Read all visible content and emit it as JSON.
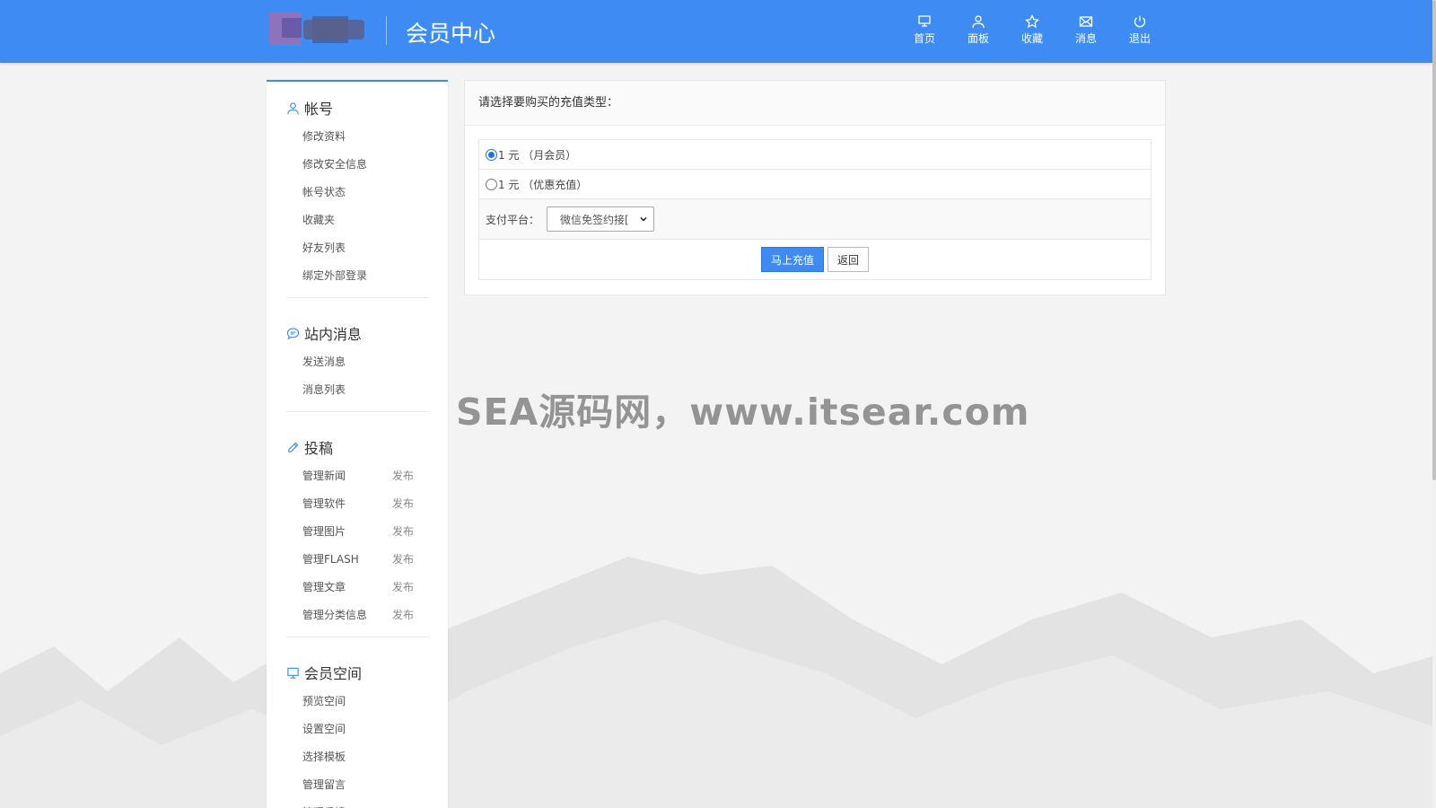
{
  "header": {
    "title": "会员中心",
    "nav": [
      {
        "label": "首页",
        "icon": "monitor-icon"
      },
      {
        "label": "面板",
        "icon": "user-icon"
      },
      {
        "label": "收藏",
        "icon": "star-icon"
      },
      {
        "label": "消息",
        "icon": "mail-icon"
      },
      {
        "label": "退出",
        "icon": "power-icon"
      }
    ]
  },
  "sidebar": {
    "groups": [
      {
        "title": "帐号",
        "icon": "user-outline-icon",
        "links": [
          {
            "label": "修改资料"
          },
          {
            "label": "修改安全信息"
          },
          {
            "label": "帐号状态"
          },
          {
            "label": "收藏夹"
          },
          {
            "label": "好友列表"
          },
          {
            "label": "绑定外部登录"
          }
        ]
      },
      {
        "title": "站内消息",
        "icon": "chat-bubble-icon",
        "links": [
          {
            "label": "发送消息"
          },
          {
            "label": "消息列表"
          }
        ]
      },
      {
        "title": "投稿",
        "icon": "pen-icon",
        "links": [
          {
            "label": "管理新闻",
            "action": "发布"
          },
          {
            "label": "管理软件",
            "action": "发布"
          },
          {
            "label": "管理图片",
            "action": "发布"
          },
          {
            "label": "管理FLASH",
            "action": "发布"
          },
          {
            "label": "管理文章",
            "action": "发布"
          },
          {
            "label": "管理分类信息",
            "action": "发布"
          }
        ]
      },
      {
        "title": "会员空间",
        "icon": "computer-icon",
        "links": [
          {
            "label": "预览空间"
          },
          {
            "label": "设置空间"
          },
          {
            "label": "选择模板"
          },
          {
            "label": "管理留言"
          },
          {
            "label": "管理反馈"
          }
        ]
      }
    ]
  },
  "panel": {
    "heading": "请选择要购买的充值类型：",
    "options": [
      {
        "label": "1 元 （月会员）",
        "selected": true
      },
      {
        "label": "1 元 （优惠充值）",
        "selected": false
      }
    ],
    "pay_label": "支付平台：",
    "pay_select_value": "微信免签约接[",
    "submit_label": "马上充值",
    "back_label": "返回"
  },
  "watermark": "SEA源码网，www.itsear.com",
  "colors": {
    "accent": "#3e8cf3",
    "background": "#f3f3f3"
  }
}
